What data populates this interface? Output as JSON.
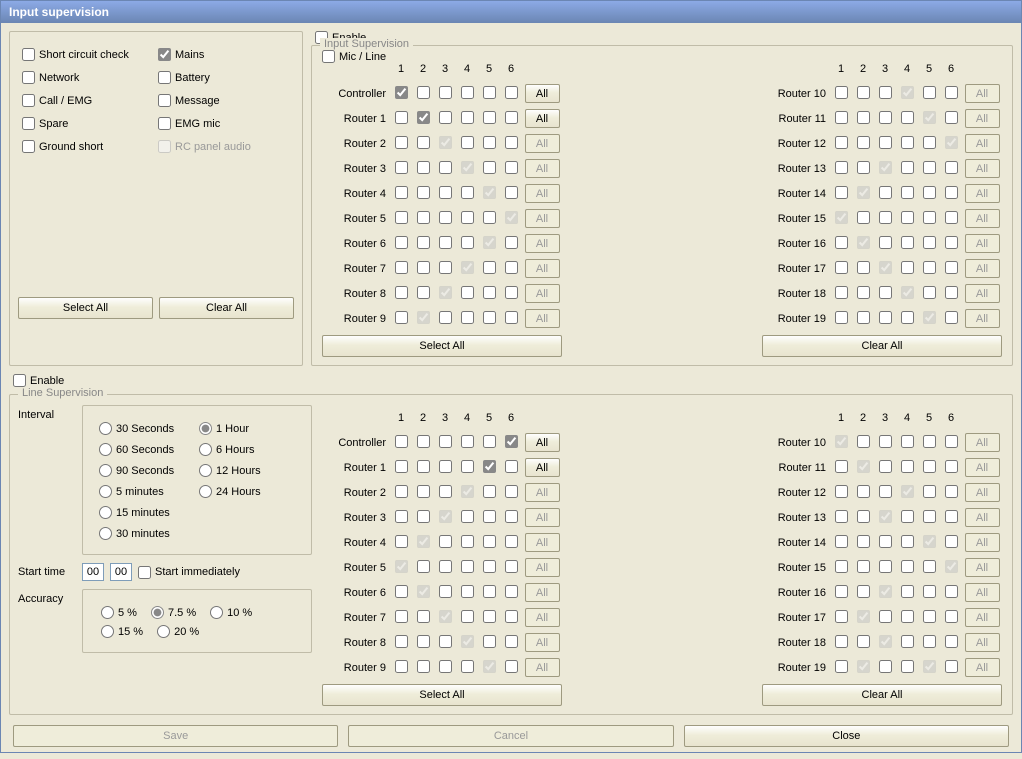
{
  "window_title": "Input supervision",
  "checks": {
    "short_circuit": "Short circuit check",
    "mains": "Mains",
    "network": "Network",
    "battery": "Battery",
    "call_emg": "Call / EMG",
    "message": "Message",
    "spare": "Spare",
    "emg_mic": "EMG mic",
    "ground_short": "Ground short",
    "rc_panel_audio": "RC panel audio"
  },
  "btns": {
    "select_all": "Select All",
    "clear_all": "Clear All",
    "all": "All",
    "save": "Save",
    "cancel": "Cancel",
    "close": "Close"
  },
  "labels": {
    "enable": "Enable",
    "input_supervision": "Input Supervision",
    "mic_line": "Mic / Line",
    "line_supervision": "Line Supervision",
    "interval": "Interval",
    "start_time": "Start time",
    "start_immediately": "Start immediately",
    "accuracy": "Accuracy",
    "controller": "Controller"
  },
  "router_prefix": "Router ",
  "columns": [
    "1",
    "2",
    "3",
    "4",
    "5",
    "6"
  ],
  "intervals": [
    "30 Seconds",
    "1 Hour",
    "60 Seconds",
    "6 Hours",
    "90 Seconds",
    "12 Hours",
    "5 minutes",
    "24 Hours",
    "15 minutes",
    "",
    "30 minutes",
    ""
  ],
  "accuracy_opts": [
    "5 %",
    "7.5 %",
    "10 %",
    "15 %",
    "20 %"
  ],
  "start_time_vals": [
    "00",
    "00"
  ],
  "input_sup": {
    "left": [
      {
        "label": "Controller",
        "checks": [
          true,
          false,
          false,
          false,
          false,
          false
        ],
        "all_enabled": true
      },
      {
        "label": "Router 1",
        "checks": [
          false,
          true,
          false,
          false,
          false,
          false
        ],
        "all_enabled": true
      },
      {
        "label": "Router 2",
        "checks": [
          false,
          false,
          "g",
          false,
          false,
          false
        ],
        "all_enabled": false
      },
      {
        "label": "Router 3",
        "checks": [
          false,
          false,
          false,
          "g",
          false,
          false
        ],
        "all_enabled": false
      },
      {
        "label": "Router 4",
        "checks": [
          false,
          false,
          false,
          false,
          "g",
          false
        ],
        "all_enabled": false
      },
      {
        "label": "Router 5",
        "checks": [
          false,
          false,
          false,
          false,
          false,
          "g"
        ],
        "all_enabled": false
      },
      {
        "label": "Router 6",
        "checks": [
          false,
          false,
          false,
          false,
          "g",
          false
        ],
        "all_enabled": false
      },
      {
        "label": "Router 7",
        "checks": [
          false,
          false,
          false,
          "g",
          false,
          false
        ],
        "all_enabled": false
      },
      {
        "label": "Router 8",
        "checks": [
          false,
          false,
          "g",
          false,
          false,
          false
        ],
        "all_enabled": false
      },
      {
        "label": "Router 9",
        "checks": [
          false,
          "g",
          false,
          false,
          false,
          false
        ],
        "all_enabled": false
      }
    ],
    "right": [
      {
        "label": "Router 10",
        "checks": [
          false,
          false,
          false,
          "g",
          false,
          false
        ],
        "all_enabled": false
      },
      {
        "label": "Router 11",
        "checks": [
          false,
          false,
          false,
          false,
          "g",
          false
        ],
        "all_enabled": false
      },
      {
        "label": "Router 12",
        "checks": [
          false,
          false,
          false,
          false,
          false,
          "g"
        ],
        "all_enabled": false
      },
      {
        "label": "Router 13",
        "checks": [
          false,
          false,
          "g",
          false,
          false,
          false
        ],
        "all_enabled": false
      },
      {
        "label": "Router 14",
        "checks": [
          false,
          "g",
          false,
          false,
          false,
          false
        ],
        "all_enabled": false
      },
      {
        "label": "Router 15",
        "checks": [
          "g",
          false,
          false,
          false,
          false,
          false
        ],
        "all_enabled": false
      },
      {
        "label": "Router 16",
        "checks": [
          false,
          "g",
          false,
          false,
          false,
          false
        ],
        "all_enabled": false
      },
      {
        "label": "Router 17",
        "checks": [
          false,
          false,
          "g",
          false,
          false,
          false
        ],
        "all_enabled": false
      },
      {
        "label": "Router 18",
        "checks": [
          false,
          false,
          false,
          "g",
          false,
          false
        ],
        "all_enabled": false
      },
      {
        "label": "Router 19",
        "checks": [
          false,
          false,
          false,
          false,
          "g",
          false
        ],
        "all_enabled": false
      }
    ]
  },
  "line_sup": {
    "left": [
      {
        "label": "Controller",
        "checks": [
          false,
          false,
          false,
          false,
          false,
          true
        ],
        "all_enabled": true
      },
      {
        "label": "Router 1",
        "checks": [
          false,
          false,
          false,
          false,
          true,
          false
        ],
        "all_enabled": true
      },
      {
        "label": "Router 2",
        "checks": [
          false,
          false,
          false,
          "g",
          false,
          false
        ],
        "all_enabled": false
      },
      {
        "label": "Router 3",
        "checks": [
          false,
          false,
          "g",
          false,
          false,
          false
        ],
        "all_enabled": false
      },
      {
        "label": "Router 4",
        "checks": [
          false,
          "g",
          false,
          false,
          false,
          false
        ],
        "all_enabled": false
      },
      {
        "label": "Router 5",
        "checks": [
          "g",
          false,
          false,
          false,
          false,
          false
        ],
        "all_enabled": false
      },
      {
        "label": "Router 6",
        "checks": [
          false,
          "g",
          false,
          false,
          false,
          false
        ],
        "all_enabled": false
      },
      {
        "label": "Router 7",
        "checks": [
          false,
          false,
          "g",
          false,
          false,
          false
        ],
        "all_enabled": false
      },
      {
        "label": "Router 8",
        "checks": [
          false,
          false,
          false,
          "g",
          false,
          false
        ],
        "all_enabled": false
      },
      {
        "label": "Router 9",
        "checks": [
          false,
          false,
          false,
          false,
          "g",
          false
        ],
        "all_enabled": false
      }
    ],
    "right": [
      {
        "label": "Router 10",
        "checks": [
          "g",
          false,
          false,
          false,
          false,
          false
        ],
        "all_enabled": false
      },
      {
        "label": "Router 11",
        "checks": [
          false,
          "g",
          false,
          false,
          false,
          false
        ],
        "all_enabled": false
      },
      {
        "label": "Router 12",
        "checks": [
          false,
          false,
          false,
          "g",
          false,
          false
        ],
        "all_enabled": false
      },
      {
        "label": "Router 13",
        "checks": [
          false,
          false,
          "g",
          false,
          false,
          false
        ],
        "all_enabled": false
      },
      {
        "label": "Router 14",
        "checks": [
          false,
          false,
          false,
          false,
          "g",
          false
        ],
        "all_enabled": false
      },
      {
        "label": "Router 15",
        "checks": [
          false,
          false,
          false,
          false,
          false,
          "g"
        ],
        "all_enabled": false
      },
      {
        "label": "Router 16",
        "checks": [
          false,
          false,
          "g",
          false,
          false,
          false
        ],
        "all_enabled": false
      },
      {
        "label": "Router 17",
        "checks": [
          false,
          "g",
          false,
          false,
          false,
          false
        ],
        "all_enabled": false
      },
      {
        "label": "Router 18",
        "checks": [
          false,
          false,
          "g",
          false,
          false,
          false
        ],
        "all_enabled": false
      },
      {
        "label": "Router 19",
        "checks": [
          false,
          "g",
          false,
          false,
          "g",
          false
        ],
        "all_enabled": false
      }
    ]
  },
  "interval_sel": 1,
  "accuracy_sel": 1,
  "chart_data": null
}
